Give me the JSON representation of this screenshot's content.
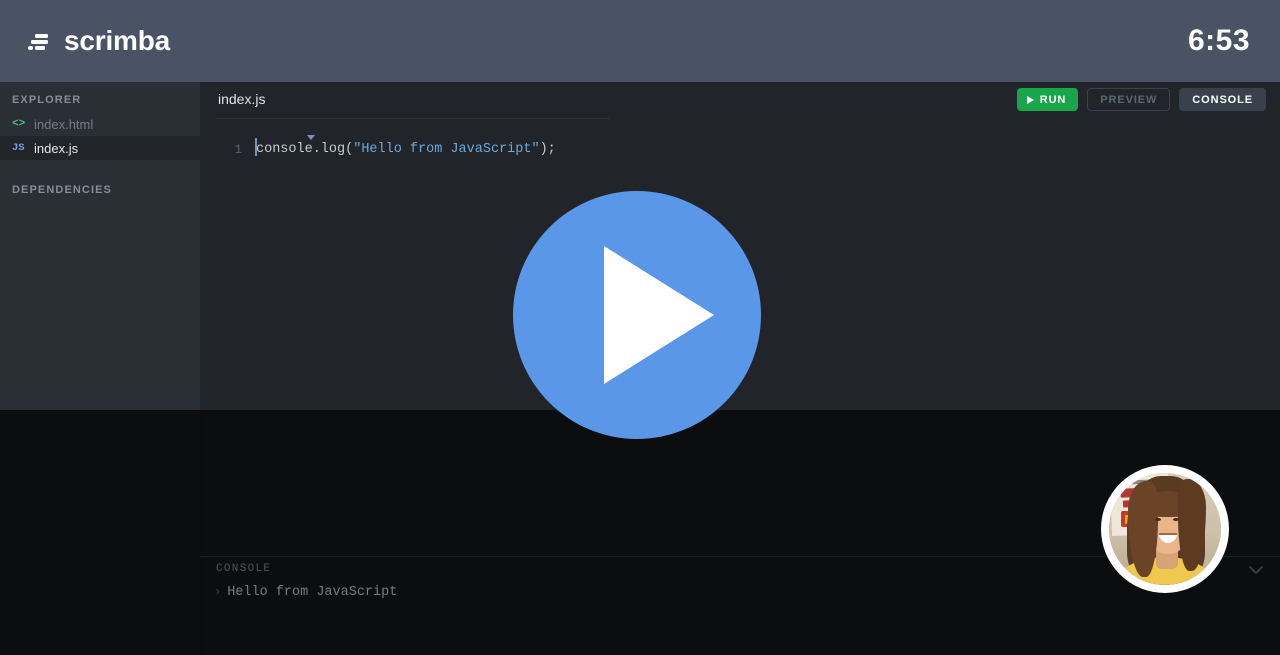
{
  "header": {
    "brand": "scrimba",
    "logo_icon": "scrimba-logo-icon",
    "timer": "6:53"
  },
  "sidebar": {
    "explorer_label": "EXPLORER",
    "dependencies_label": "DEPENDENCIES",
    "files": [
      {
        "name": "index.html",
        "icon": "html-file-icon",
        "icon_glyph": "<>",
        "active": false
      },
      {
        "name": "index.js",
        "icon": "js-file-icon",
        "icon_glyph": "JS",
        "active": true
      }
    ]
  },
  "editor": {
    "tab_title": "index.js",
    "line_number": "1",
    "code_prefix": "console.log(",
    "code_string": "\"Hello from JavaScript\"",
    "code_suffix": ");"
  },
  "toolbar": {
    "run_label": "RUN",
    "run_icon": "play-icon",
    "preview_label": "PREVIEW",
    "console_label": "CONSOLE"
  },
  "console": {
    "panel_label": "CONSOLE",
    "collapse_icon": "chevron-down-icon",
    "prompt_glyph": "›",
    "output": "Hello from JavaScript"
  },
  "player": {
    "play_icon": "play-icon",
    "avatar_icon": "webcam-avatar"
  },
  "colors": {
    "header_bg": "#4a5365",
    "sidebar_bg": "#2a2e35",
    "editor_bg": "#212429",
    "dim_bg": "#0c0d0e",
    "play_blue": "#5b97e8",
    "run_green": "#19a54a",
    "console_btn": "#39414f",
    "string_token": "#6aa9dd"
  }
}
